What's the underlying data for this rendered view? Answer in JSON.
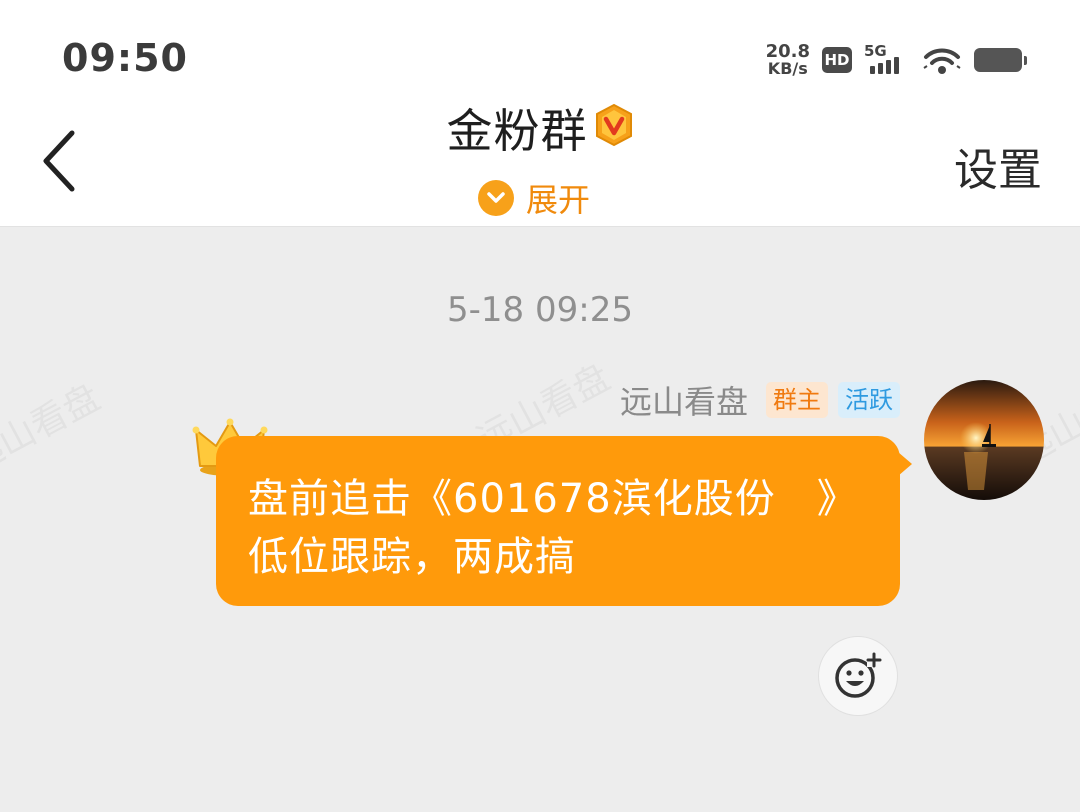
{
  "status_bar": {
    "time": "09:50",
    "net_speed_value": "20.8",
    "net_speed_unit": "KB/s",
    "hd_label": "HD",
    "network_label": "5G"
  },
  "header": {
    "title": "金粉群",
    "expand_label": "展开",
    "settings_label": "设置",
    "accent_color": "#f7a11a"
  },
  "watermarks": [
    "远山看盘",
    "远山看盘",
    "远山看盘"
  ],
  "chat": {
    "timestamp": "5-18 09:25",
    "messages": [
      {
        "sender": "远山看盘",
        "tags": {
          "owner": "群主",
          "active": "活跃"
        },
        "text": "盘前追击《601678滨化股份　》低位跟踪，两成搞",
        "bubble_color": "#ff9a0b"
      }
    ]
  }
}
